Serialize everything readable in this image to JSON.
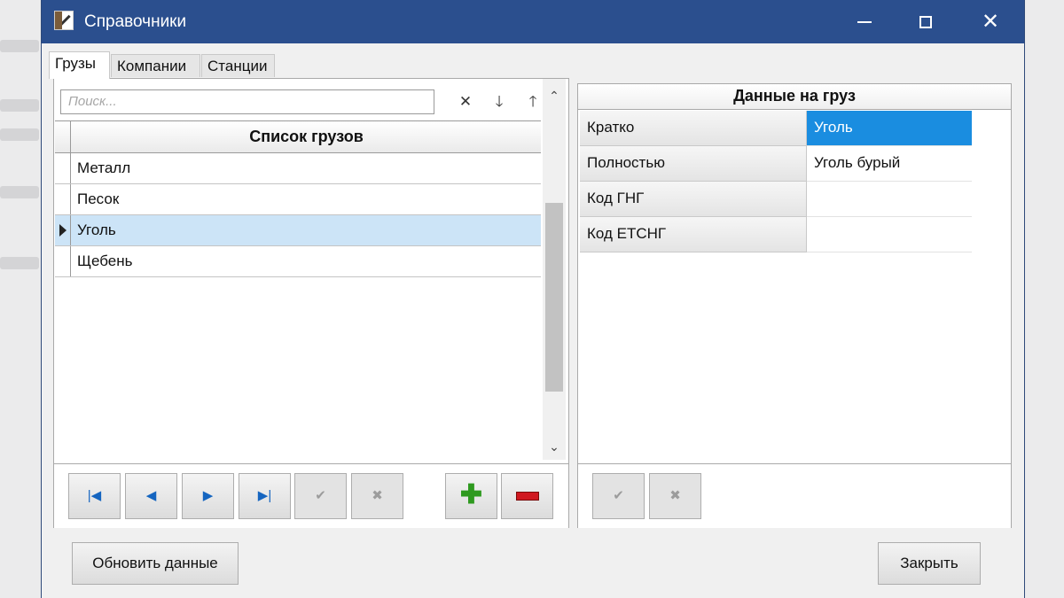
{
  "window": {
    "title": "Справочники",
    "controls": {
      "minimize": "minimize-icon",
      "maximize": "maximize-icon",
      "close": "✕"
    }
  },
  "tabs": [
    {
      "label": "Грузы",
      "active": true
    },
    {
      "label": "Компании",
      "active": false
    },
    {
      "label": "Станции",
      "active": false
    }
  ],
  "search": {
    "placeholder": "Поиск...",
    "value": ""
  },
  "search_tools": {
    "clear": "✕",
    "down": "🡓",
    "up": "🡑"
  },
  "cargo_list": {
    "header": "Список грузов",
    "rows": [
      {
        "name": "Металл",
        "selected": false
      },
      {
        "name": "Песок",
        "selected": false
      },
      {
        "name": "Уголь",
        "selected": true
      },
      {
        "name": "Щебень",
        "selected": false
      }
    ]
  },
  "scrollbar": {
    "up": "⌃",
    "down": "⌄"
  },
  "left_nav": {
    "first": "|◀",
    "prev": "◀",
    "next": "▶",
    "last": "▶|",
    "post": "✔",
    "cancel": "✖",
    "add": "✚",
    "delete": "delete-icon"
  },
  "details": {
    "title": "Данные на груз",
    "rows": [
      {
        "label": "Кратко",
        "value": "Уголь",
        "selected": true
      },
      {
        "label": "Полностью",
        "value": "Уголь бурый",
        "selected": false
      },
      {
        "label": "Код ГНГ",
        "value": "",
        "selected": false
      },
      {
        "label": "Код ЕТСНГ",
        "value": "",
        "selected": false
      }
    ]
  },
  "right_nav": {
    "post": "✔",
    "cancel": "✖"
  },
  "buttons": {
    "refresh": "Обновить данные",
    "close": "Закрыть"
  },
  "colors": {
    "titlebar": "#2b4f8e",
    "selection": "#1a8de0",
    "row_highlight": "#cce4f7"
  }
}
